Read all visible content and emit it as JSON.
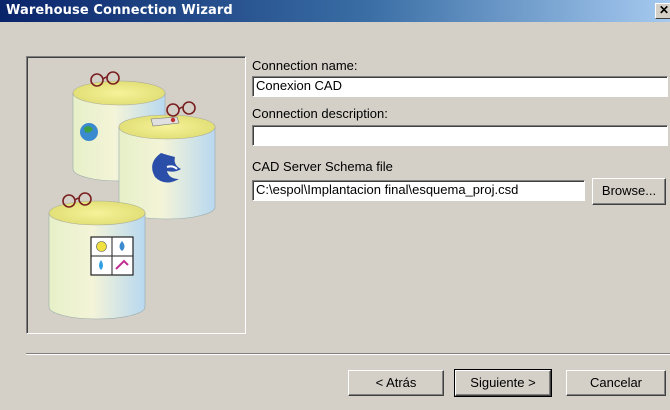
{
  "window": {
    "title": "Warehouse Connection Wizard"
  },
  "form": {
    "connection_name_label": "Connection name:",
    "connection_name_value": "Conexion CAD",
    "connection_description_label": "Connection description:",
    "connection_description_value": "",
    "schema_file_label": "CAD Server Schema file",
    "schema_file_value": "C:\\espol\\Implantacion final\\esquema_proj.csd",
    "browse_label": "Browse..."
  },
  "buttons": {
    "back": "< Atrás",
    "next": "Siguiente >",
    "cancel": "Cancelar"
  },
  "icons": {
    "close": "close-icon",
    "illustration": "database-cylinders-illustration"
  }
}
